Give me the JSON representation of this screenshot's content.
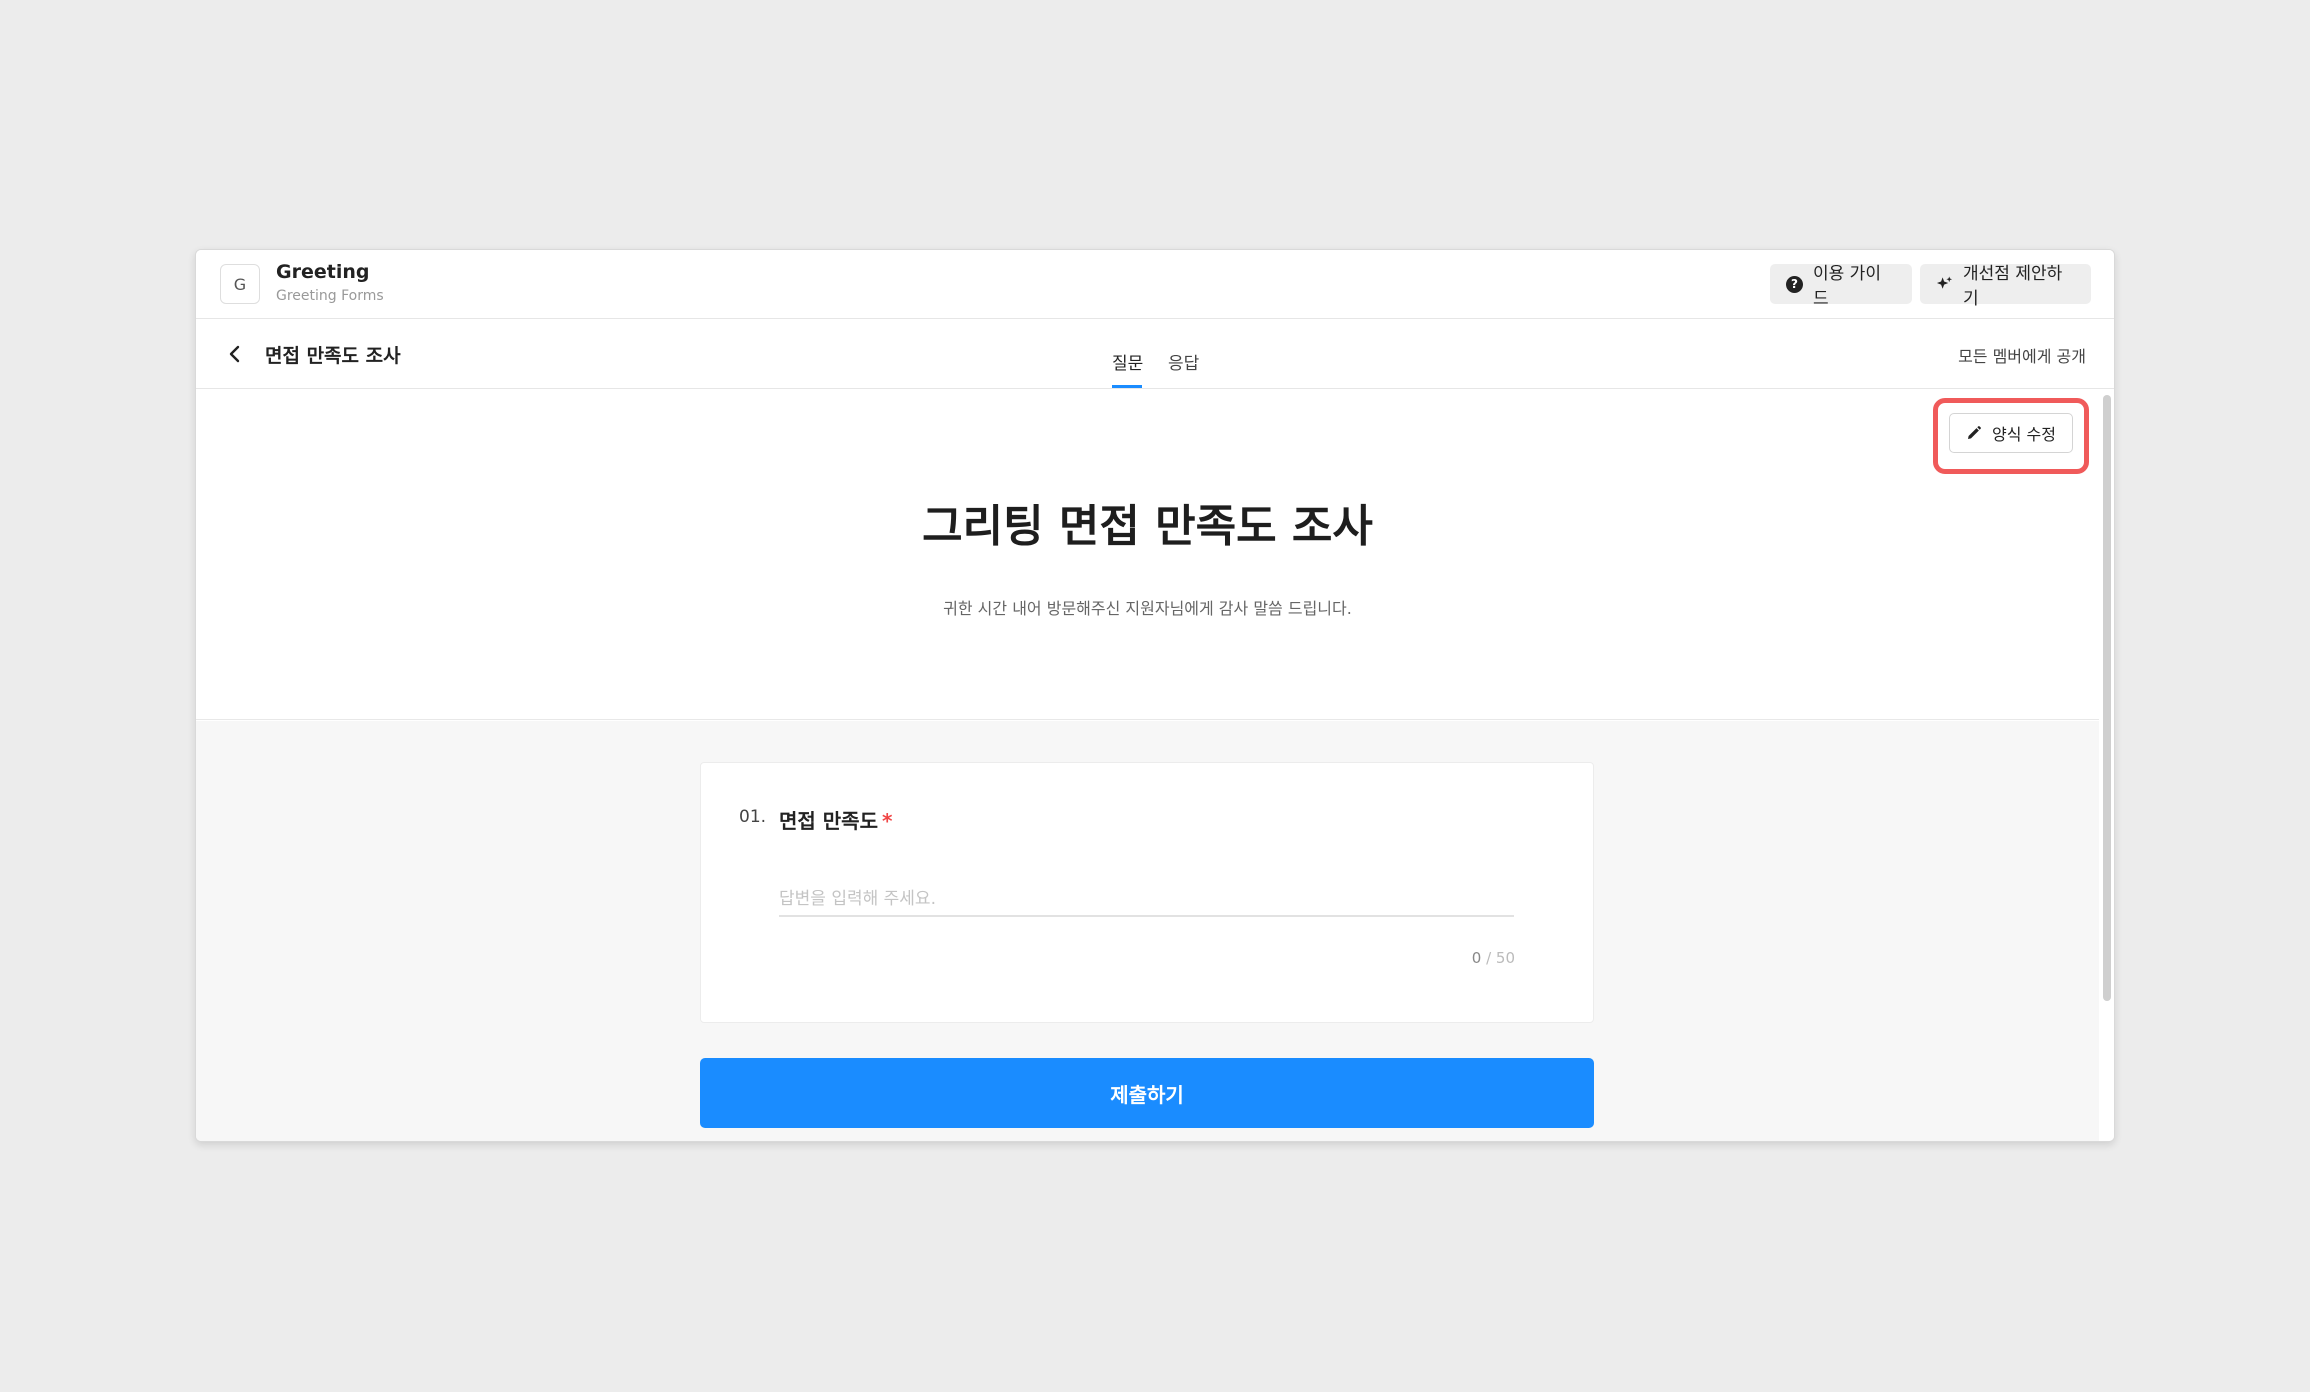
{
  "app": {
    "logo_letter": "G",
    "title": "Greeting",
    "subtitle": "Greeting Forms"
  },
  "toolbar": {
    "guide_label": "이용 가이드",
    "suggest_label": "개선점 제안하기",
    "guide_icon": "help-circle-icon",
    "suggest_icon": "sparkle-icon"
  },
  "subheader": {
    "back_icon": "chevron-left-icon",
    "form_name": "면접 만족도 조사",
    "tabs": [
      {
        "label": "질문",
        "active": true
      },
      {
        "label": "응답",
        "active": false
      }
    ],
    "visibility": "모든 멤버에게 공개"
  },
  "form": {
    "edit_label": "양식 수정",
    "edit_icon": "pencil-icon",
    "title": "그리팅 면접 만족도 조사",
    "description": "귀한 시간 내어 방문해주신 지원자님에게 감사 말씀 드립니다.",
    "questions": [
      {
        "number": "01.",
        "title": "면접 만족도",
        "required_mark": "*",
        "placeholder": "답변을 입력해 주세요.",
        "value": "",
        "count": "0",
        "max": "/ 50"
      }
    ],
    "submit_label": "제출하기"
  },
  "colors": {
    "accent": "#1a8cff",
    "highlight": "#f05a5a",
    "required": "#f04646",
    "page_background": "#ececec"
  }
}
